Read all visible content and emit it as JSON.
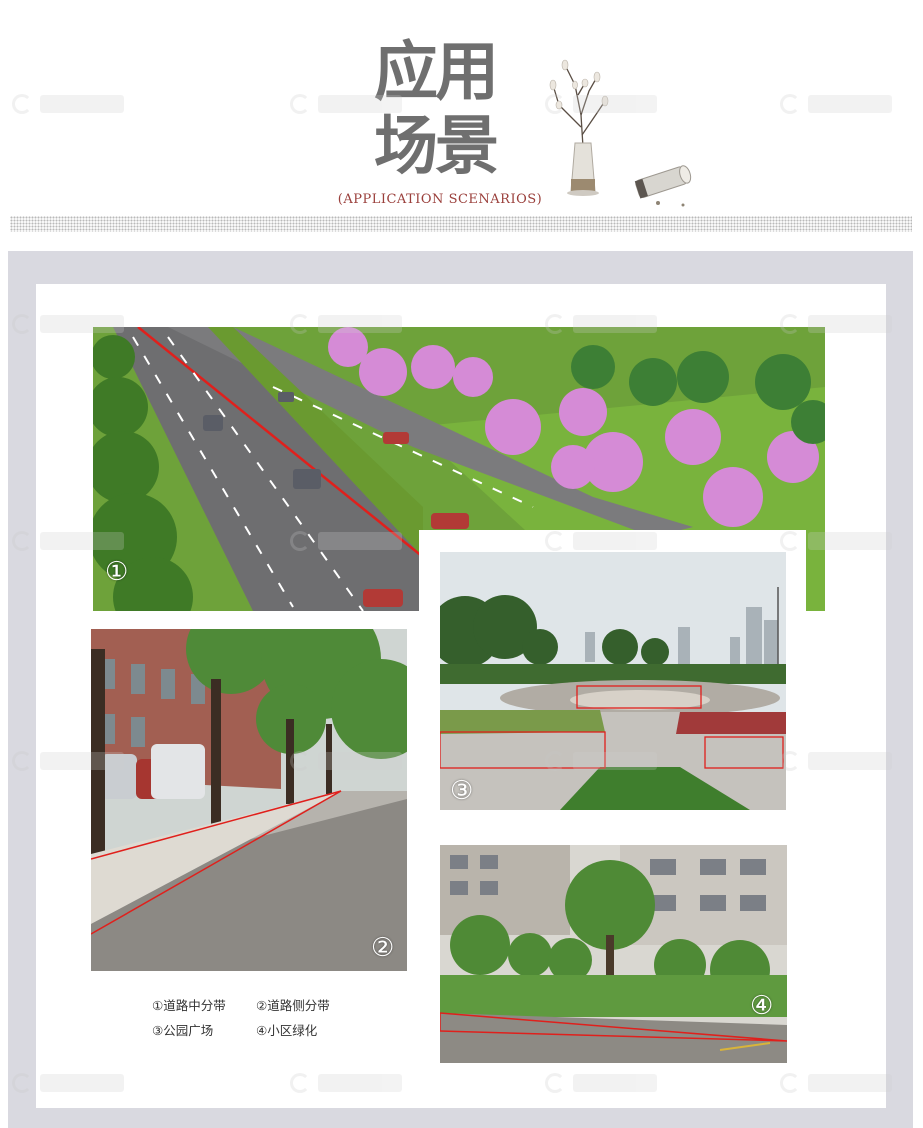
{
  "header": {
    "title_line1": "应用",
    "title_line2": "场景",
    "subtitle": "(APPLICATION SCENARIOS)"
  },
  "photos": [
    {
      "number": "①"
    },
    {
      "number": "②"
    },
    {
      "number": "③"
    },
    {
      "number": "④"
    }
  ],
  "caption": {
    "row1": [
      "①道路中分带",
      "②道路侧分带"
    ],
    "row2": [
      "③公园广场",
      "④小区绿化"
    ]
  },
  "colors": {
    "title": "#6f6f6f",
    "subtitle": "#9a3f3b",
    "frame": "#d9d9e0",
    "highlight": "#e0201c"
  },
  "icons": [
    "vase-icon",
    "bamboo-tube-icon",
    "watermark-logo-icon"
  ]
}
